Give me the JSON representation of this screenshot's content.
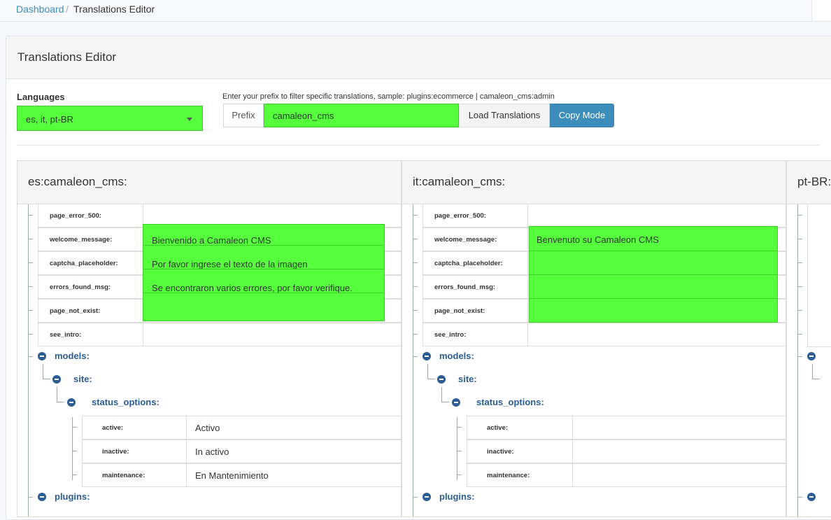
{
  "breadcrumb": {
    "home": "Dashboard",
    "separator": "/",
    "current": "Translations Editor"
  },
  "panel": {
    "title": "Translations Editor"
  },
  "languages": {
    "label": "Languages",
    "value": "es, it, pt-BR"
  },
  "prefix": {
    "hint": "Enter your prefix to filter specific translations, sample: plugins:ecommerce | camaleon_cms:admin",
    "addon": "Prefix",
    "value": "camaleon_cms",
    "load_button": "Load Translations",
    "copy_button": "Copy Mode"
  },
  "columns": [
    {
      "title": "es:camaleon_cms:",
      "rows": [
        {
          "key": "page_error_500:",
          "value": ""
        },
        {
          "key": "welcome_message:",
          "value": "Bienvenido a Camaleon CMS"
        },
        {
          "key": "captcha_placeholder:",
          "value": "Por favor ingrese el texto de la imagen"
        },
        {
          "key": "errors_found_msg:",
          "value": "Se encontraron varios errores, por favor verifique."
        },
        {
          "key": "page_not_exist:",
          "value": ""
        },
        {
          "key": "see_intro:",
          "value": ""
        }
      ],
      "nodes": {
        "models": "models:",
        "site": "site:",
        "status_options": "status_options:",
        "plugins": "plugins:"
      },
      "status_rows": [
        {
          "key": "active:",
          "value": "Activo"
        },
        {
          "key": "inactive:",
          "value": "In activo"
        },
        {
          "key": "maintenance:",
          "value": "En Mantenimiento"
        }
      ]
    },
    {
      "title": "it:camaleon_cms:",
      "rows": [
        {
          "key": "page_error_500:",
          "value": ""
        },
        {
          "key": "welcome_message:",
          "value": "Benvenuto su Camaleon CMS"
        },
        {
          "key": "captcha_placeholder:",
          "value": ""
        },
        {
          "key": "errors_found_msg:",
          "value": ""
        },
        {
          "key": "page_not_exist:",
          "value": ""
        },
        {
          "key": "see_intro:",
          "value": ""
        }
      ],
      "nodes": {
        "models": "models:",
        "site": "site:",
        "status_options": "status_options:",
        "plugins": "plugins:"
      },
      "status_rows": [
        {
          "key": "active:",
          "value": ""
        },
        {
          "key": "inactive:",
          "value": ""
        },
        {
          "key": "maintenance:",
          "value": ""
        }
      ]
    },
    {
      "title": "pt-BR:camaleon_cms:"
    }
  ],
  "colors": {
    "highlight": "#55ff3b",
    "primary": "#3c8dbc",
    "tree": "#2c5d94"
  }
}
